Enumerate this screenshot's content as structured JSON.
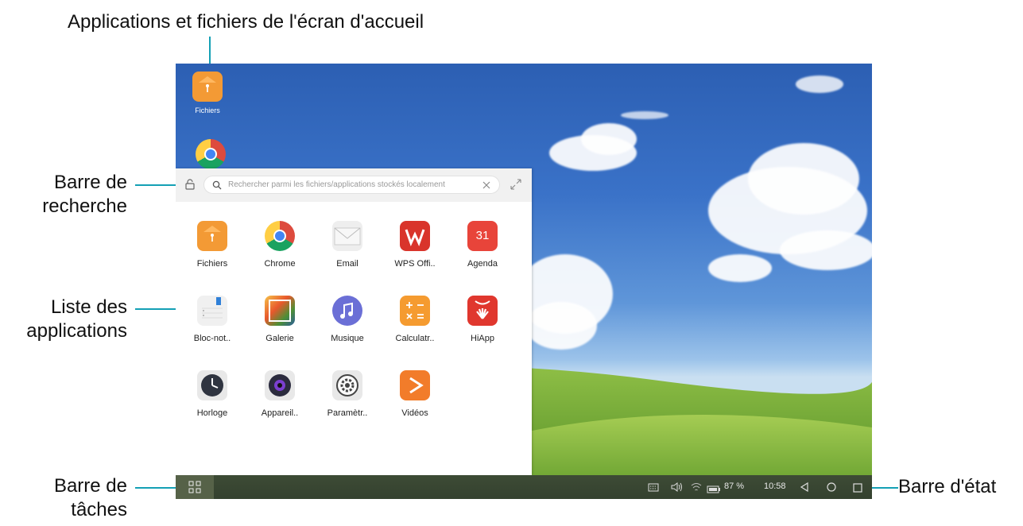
{
  "callouts": {
    "home_apps": "Applications et fichiers de l'écran d'accueil",
    "search_bar_l1": "Barre de",
    "search_bar_l2": "recherche",
    "app_list_l1": "Liste des",
    "app_list_l2": "applications",
    "taskbar_l1": "Barre de",
    "taskbar_l2": "tâches",
    "status_bar": "Barre d'état"
  },
  "desktop": {
    "icons": [
      {
        "label": "Fichiers",
        "icon": "files-icon"
      },
      {
        "label": "",
        "icon": "chrome-icon"
      }
    ]
  },
  "search": {
    "placeholder": "Rechercher parmi les fichiers/applications stockés localement"
  },
  "apps": [
    {
      "label": "Fichiers",
      "icon": "files-icon",
      "color": "#f39a35"
    },
    {
      "label": "Chrome",
      "icon": "chrome-icon",
      "color": "#ffffff"
    },
    {
      "label": "Email",
      "icon": "email-icon",
      "color": "#eeeeee"
    },
    {
      "label": "WPS Offi..",
      "icon": "wps-office-icon",
      "color": "#d9342b"
    },
    {
      "label": "Agenda",
      "icon": "calendar-icon",
      "color": "#e8443a",
      "badge": "31"
    },
    {
      "label": "Bloc-not..",
      "icon": "notepad-icon",
      "color": "#f0f0f0"
    },
    {
      "label": "Galerie",
      "icon": "gallery-icon",
      "color": "#6a7f3a"
    },
    {
      "label": "Musique",
      "icon": "music-icon",
      "color": "#6b6fd6"
    },
    {
      "label": "Calculatr..",
      "icon": "calculator-icon",
      "color": "#f59b30"
    },
    {
      "label": "HiApp",
      "icon": "hiapp-icon",
      "color": "#e0372e"
    },
    {
      "label": "Horloge",
      "icon": "clock-icon",
      "color": "#e8e8e8"
    },
    {
      "label": "Appareil..",
      "icon": "camera-icon",
      "color": "#e8e8e8"
    },
    {
      "label": "Paramètr..",
      "icon": "settings-icon",
      "color": "#e8e8e8"
    },
    {
      "label": "Vidéos",
      "icon": "videos-icon",
      "color": "#f27c2a"
    }
  ],
  "status": {
    "battery": "87 %",
    "time": "10:58"
  }
}
